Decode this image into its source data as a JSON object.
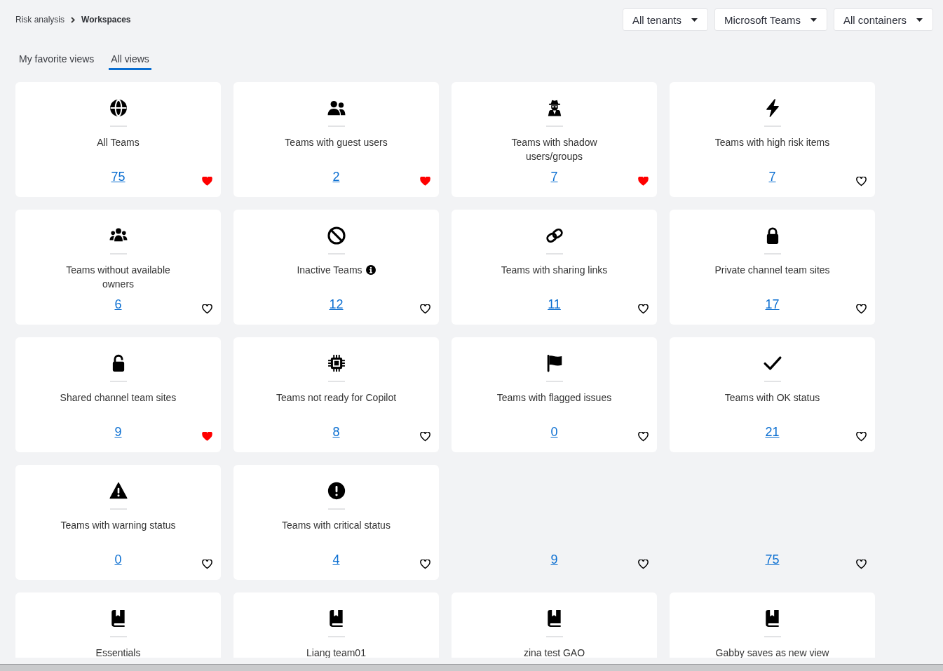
{
  "breadcrumb": [
    {
      "label": "Risk analysis",
      "current": false
    },
    {
      "label": "Workspaces",
      "current": true
    }
  ],
  "filters": [
    "All tenants",
    "Microsoft Teams",
    "All containers"
  ],
  "tabs": [
    {
      "label": "My favorite views",
      "selected": false
    },
    {
      "label": "All views",
      "selected": true
    }
  ],
  "cards": [
    {
      "kind": "builtin",
      "title": "All Teams",
      "count": "75",
      "favorite": true
    },
    {
      "kind": "builtin",
      "title": "Teams with guest users",
      "count": "2",
      "favorite": true
    },
    {
      "kind": "builtin",
      "title": "Teams with shadow users/groups",
      "count": "7",
      "favorite": true
    },
    {
      "kind": "builtin",
      "title": "Teams with high risk items",
      "count": "7",
      "favorite": false
    },
    {
      "kind": "builtin",
      "title": "Teams without available owners",
      "count": "6",
      "favorite": false
    },
    {
      "kind": "builtin",
      "title": "Inactive Teams",
      "info": true,
      "count": "12",
      "favorite": false
    },
    {
      "kind": "builtin",
      "title": "Teams with sharing links",
      "count": "11",
      "favorite": false
    },
    {
      "kind": "builtin",
      "title": "Private channel team sites",
      "count": "17",
      "favorite": false
    },
    {
      "kind": "builtin",
      "title": "Shared channel team sites",
      "count": "9",
      "favorite": true
    },
    {
      "kind": "builtin",
      "title": "Teams not ready for Copilot",
      "count": "8",
      "favorite": false
    },
    {
      "kind": "builtin",
      "title": "Teams with flagged issues",
      "count": "0",
      "favorite": false
    },
    {
      "kind": "builtin",
      "title": "Teams with OK status",
      "count": "21",
      "favorite": false
    },
    {
      "kind": "builtin",
      "title": "Teams with warning status",
      "count": "0",
      "favorite": false
    },
    {
      "kind": "builtin",
      "title": "Teams with critical status",
      "count": "4",
      "favorite": false
    },
    {
      "kind": "pending",
      "count": "9",
      "favorite": false
    },
    {
      "kind": "pending",
      "count": "75",
      "favorite": false
    },
    {
      "kind": "saved",
      "title": "Essentials"
    },
    {
      "kind": "saved",
      "title": "Liang team01"
    },
    {
      "kind": "saved",
      "title": "zina test GAO"
    },
    {
      "kind": "saved",
      "title": "Gabby saves as new view"
    }
  ]
}
